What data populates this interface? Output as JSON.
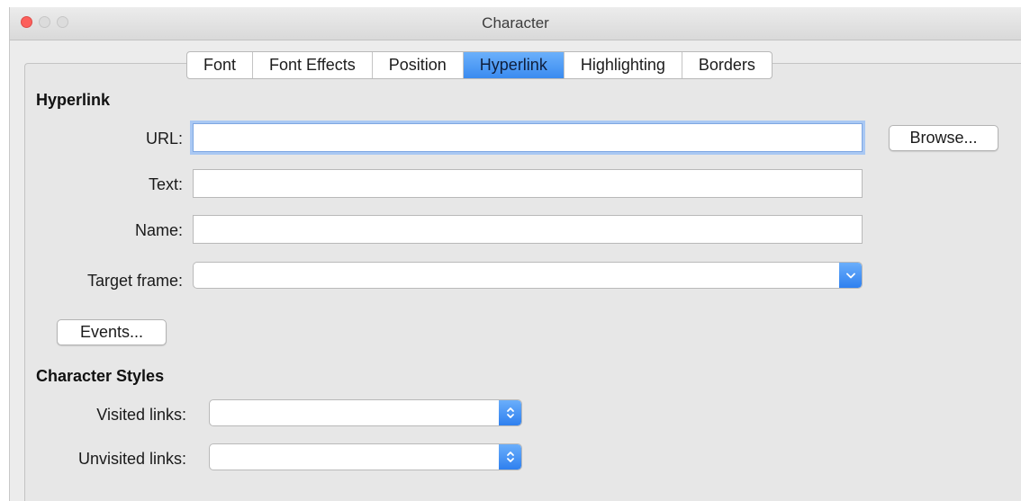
{
  "window": {
    "title": "Character"
  },
  "tabs": [
    {
      "label": "Font",
      "active": false
    },
    {
      "label": "Font Effects",
      "active": false
    },
    {
      "label": "Position",
      "active": false
    },
    {
      "label": "Hyperlink",
      "active": true
    },
    {
      "label": "Highlighting",
      "active": false
    },
    {
      "label": "Borders",
      "active": false
    }
  ],
  "hyperlink": {
    "section_title": "Hyperlink",
    "url_label": "URL:",
    "url_value": "",
    "browse_label": "Browse...",
    "text_label": "Text:",
    "text_value": "",
    "name_label": "Name:",
    "name_value": "",
    "target_frame_label": "Target frame:",
    "target_frame_value": "",
    "events_label": "Events..."
  },
  "character_styles": {
    "section_title": "Character Styles",
    "visited_label": "Visited links:",
    "visited_value": "",
    "unvisited_label": "Unvisited links:",
    "unvisited_value": ""
  },
  "colors": {
    "accent": "#3a8bf0",
    "close": "#fc605c"
  },
  "icons": {
    "target_frame": "chevron-down-icon",
    "styles_select": "up-down-chevron-icon"
  }
}
